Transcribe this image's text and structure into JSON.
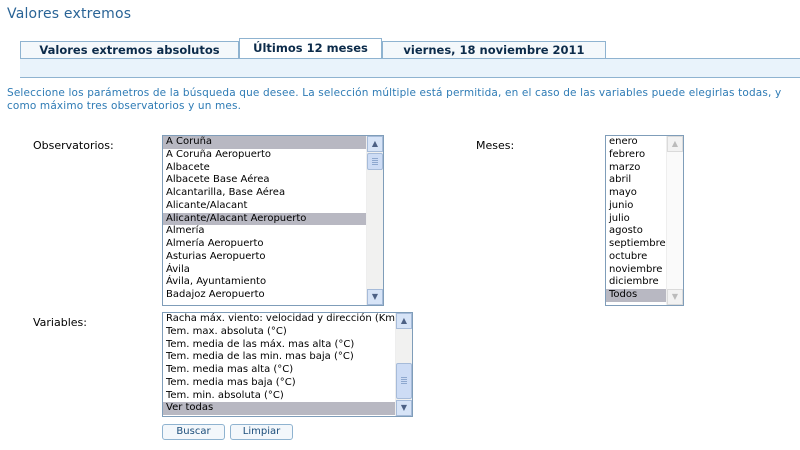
{
  "page": {
    "title": "Valores extremos"
  },
  "tabs": [
    {
      "label": "Valores extremos absolutos",
      "active": false
    },
    {
      "label": "Últimos 12 meses",
      "active": true
    },
    {
      "label": "viernes, 18 noviembre 2011",
      "active": false
    }
  ],
  "instructions": "Seleccione los parámetros de la búsqueda que desee. La selección múltiple está permitida, en el caso de las variables puede elegirlas todas, y como máximo tres observatorios y un mes.",
  "observatorios": {
    "label": "Observatorios:",
    "options": [
      {
        "text": "A Coruña",
        "selected": true
      },
      {
        "text": "A Coruña Aeropuerto",
        "selected": false
      },
      {
        "text": "Albacete",
        "selected": false
      },
      {
        "text": "Albacete Base Aérea",
        "selected": false
      },
      {
        "text": "Alcantarilla, Base Aérea",
        "selected": false
      },
      {
        "text": "Alicante/Alacant",
        "selected": false
      },
      {
        "text": "Alicante/Alacant Aeropuerto",
        "selected": true
      },
      {
        "text": "Almería",
        "selected": false
      },
      {
        "text": "Almería Aeropuerto",
        "selected": false
      },
      {
        "text": "Asturias Aeropuerto",
        "selected": false
      },
      {
        "text": "Ávila",
        "selected": false
      },
      {
        "text": "Ávila, Ayuntamiento",
        "selected": false
      },
      {
        "text": "Badajoz Aeropuerto",
        "selected": false
      }
    ]
  },
  "meses": {
    "label": "Meses:",
    "options": [
      {
        "text": "enero",
        "selected": false
      },
      {
        "text": "febrero",
        "selected": false
      },
      {
        "text": "marzo",
        "selected": false
      },
      {
        "text": "abril",
        "selected": false
      },
      {
        "text": "mayo",
        "selected": false
      },
      {
        "text": "junio",
        "selected": false
      },
      {
        "text": "julio",
        "selected": false
      },
      {
        "text": "agosto",
        "selected": false
      },
      {
        "text": "septiembre",
        "selected": false
      },
      {
        "text": "octubre",
        "selected": false
      },
      {
        "text": "noviembre",
        "selected": false
      },
      {
        "text": "diciembre",
        "selected": false
      },
      {
        "text": "Todos",
        "selected": true
      }
    ]
  },
  "variables": {
    "label": "Variables:",
    "options": [
      {
        "text": "Racha máx. viento: velocidad y dirección (Km/h)",
        "selected": false
      },
      {
        "text": "Tem. max. absoluta (°C)",
        "selected": false
      },
      {
        "text": "Tem. media de las máx. mas alta (°C)",
        "selected": false
      },
      {
        "text": "Tem. media de las min. mas baja (°C)",
        "selected": false
      },
      {
        "text": "Tem. media mas alta (°C)",
        "selected": false
      },
      {
        "text": "Tem. media mas baja (°C)",
        "selected": false
      },
      {
        "text": "Tem. min. absoluta (°C)",
        "selected": false
      },
      {
        "text": "Ver todas",
        "selected": true
      }
    ]
  },
  "buttons": {
    "search": "Buscar",
    "clear": "Limpiar"
  },
  "icons": {
    "scroll_up": "▲",
    "scroll_down": "▼"
  },
  "colors": {
    "title": "#2a6496",
    "instructions": "#2e7bb5",
    "selection": "#b8b8c2",
    "tab_border": "#8fb3d0"
  }
}
